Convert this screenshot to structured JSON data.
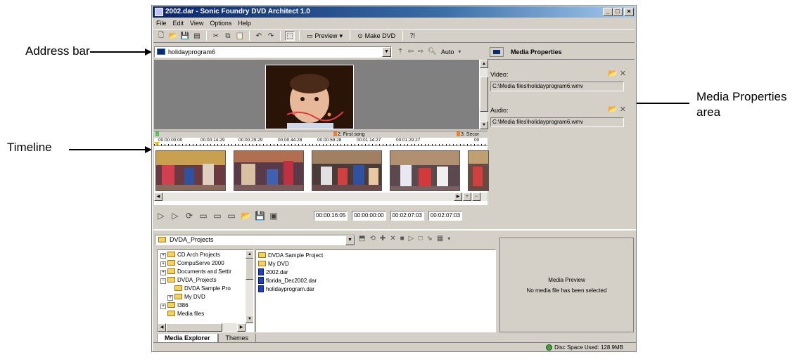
{
  "callouts": {
    "address_bar": "Address bar",
    "timeline": "Timeline",
    "media_properties_1": "Media Properties",
    "media_properties_2": "area"
  },
  "window": {
    "title": "2002.dar - Sonic Foundry DVD Architect 1.0",
    "minimize": "_",
    "maximize": "□",
    "close": "×"
  },
  "menu": [
    "File",
    "Edit",
    "View",
    "Options",
    "Help"
  ],
  "toolbar": {
    "preview_label": "Preview",
    "make_dvd_label": "Make DVD"
  },
  "address": {
    "value": "holidayprogram6",
    "zoom": "Auto"
  },
  "timeline": {
    "markers": [
      "2: First song",
      "3: Secor"
    ],
    "ticks": [
      "00:00:00:00",
      "00:00:14:29",
      "00:00:29:29",
      "00:00:44:28",
      "00:00:59:28",
      "00:01:14:27",
      "00:01:29:27",
      "00"
    ]
  },
  "transport": {
    "timecodes": [
      "00:00:16:05",
      "00:00:00:00",
      "00:02:07:03",
      "00:02:07:03"
    ]
  },
  "media_properties": {
    "title": "Media Properties",
    "video_label": "Video:",
    "video_path": "C:\\Media files\\holidayprogram6.wmv",
    "audio_label": "Audio:",
    "audio_path": "C:\\Media files\\holidayprogram6.wmv"
  },
  "explorer": {
    "folder": "DVDA_Projects",
    "tree": [
      {
        "label": "CD Arch Projects",
        "expand": "+"
      },
      {
        "label": "CompuServe 2000",
        "expand": "+"
      },
      {
        "label": "Documents and Settir",
        "expand": "+"
      },
      {
        "label": "DVDA_Projects",
        "expand": "−"
      },
      {
        "label": "DVDA Sample Pro",
        "expand": ""
      },
      {
        "label": "My DVD",
        "expand": "+"
      },
      {
        "label": "I386",
        "expand": "+"
      },
      {
        "label": "Media files",
        "expand": ""
      }
    ],
    "files": [
      {
        "label": "DVDA Sample Project",
        "type": "folder"
      },
      {
        "label": "My DVD",
        "type": "folder"
      },
      {
        "label": "2002.dar",
        "type": "file"
      },
      {
        "label": "florida_Dec2002.dar",
        "type": "file"
      },
      {
        "label": "holidayprogram.dar",
        "type": "file"
      }
    ]
  },
  "media_preview": {
    "title": "Media Preview",
    "message": "No media file has been selected"
  },
  "tabs": [
    "Media Explorer",
    "Themes"
  ],
  "status": {
    "disc_space": "Disc Space Used: 128.9MB"
  },
  "icons": [
    "new-icon",
    "open-icon",
    "save-icon",
    "cut-icon",
    "copy-icon",
    "paste-icon",
    "undo-icon",
    "redo-icon",
    "preview-icon",
    "make-dvd-icon",
    "zoom-icon",
    "play-icon",
    "folder-icon",
    "delete-icon",
    "disc-icon"
  ]
}
